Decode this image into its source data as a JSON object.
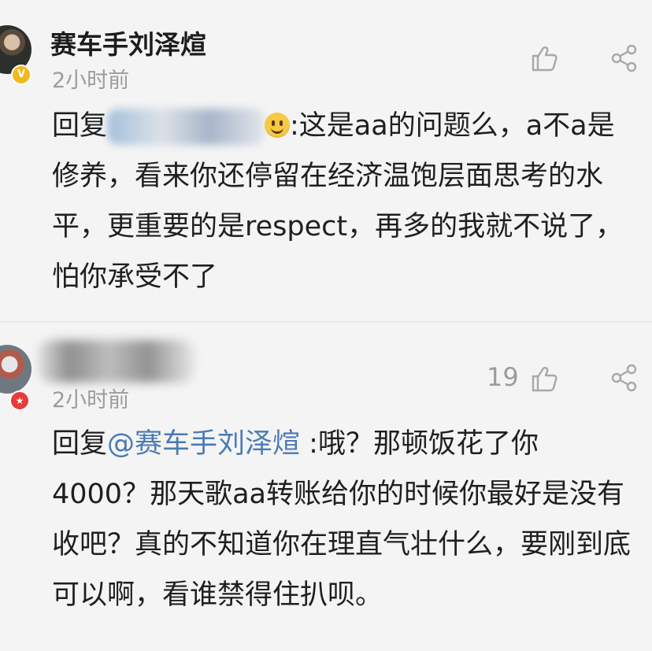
{
  "comments": [
    {
      "author": "赛车手刘泽煊",
      "time": "2小时前",
      "reply_prefix": "回复",
      "emoji_icon": "smiley-emoji",
      "text": ":这是aa的问题么，a不a是修养，看来你还停留在经济温饱层面思考的水平，更重要的是respect，再多的我就不说了，怕你承受不了",
      "badge": "V"
    },
    {
      "time": "2小时前",
      "likes": "19",
      "reply_prefix": "回复",
      "mention": "@赛车手刘泽煊",
      "text": " :哦？那顿饭花了你4000？那天歌aa转账给你的时候你最好是没有收吧？真的不知道你在理直气壮什么，要刚到底可以啊，看谁禁得住扒呗。",
      "badge": "★"
    }
  ],
  "colors": {
    "background": "#f4f4f4",
    "mention": "#4a7ab5",
    "meta_text": "#9c9c9c",
    "verified_badge": "#f3b81c",
    "member_badge": "#e83b3b"
  },
  "icons": [
    "thumbs-up-icon",
    "share-icon",
    "avatar",
    "verified-badge-icon"
  ]
}
